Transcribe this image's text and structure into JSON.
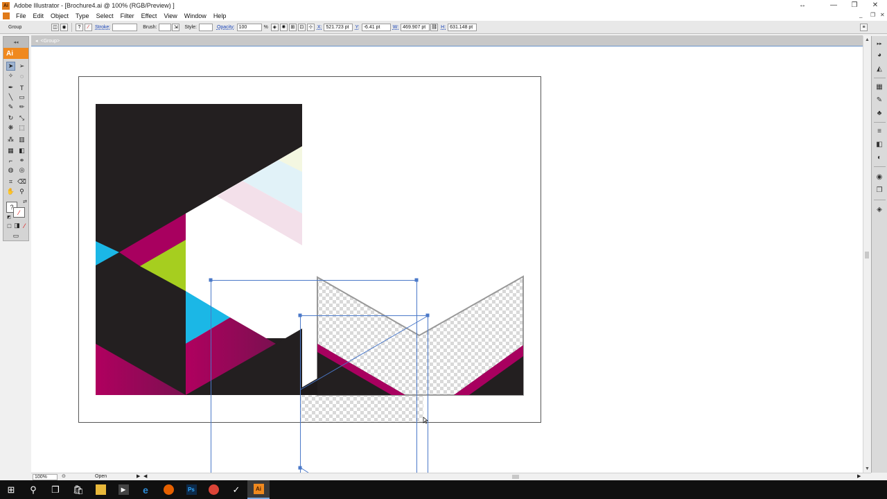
{
  "window": {
    "badge": "Ai",
    "title": "Adobe Illustrator - [Brochure4.ai @ 100% (RGB/Preview) ]"
  },
  "menu": [
    "File",
    "Edit",
    "Object",
    "Type",
    "Select",
    "Filter",
    "Effect",
    "View",
    "Window",
    "Help"
  ],
  "control_bar": {
    "selection_type": "Group",
    "stroke_label": "Stroke:",
    "brush_label": "Brush:",
    "style_label": "Style:",
    "opacity_label": "Opacity:",
    "opacity_value": "100",
    "opacity_unit": "%",
    "x_label": "X:",
    "x_value": "521.723 pt",
    "y_label": "Y:",
    "y_value": "-6.41 pt",
    "w_label": "W:",
    "w_value": "469.907 pt",
    "h_label": "H:",
    "h_value": "631.148 pt"
  },
  "document_tab": {
    "label": "<Group>"
  },
  "tools_panel": {
    "logo": "Ai"
  },
  "status_bar": {
    "zoom": "100%",
    "status": "Open"
  },
  "colors": {
    "dark": "#231f20",
    "magenta": "#a8005f",
    "cyan": "#1bb7e6",
    "lime": "#a6ce1f",
    "pale_yellow": "#f4f7e1",
    "pale_blue": "#e1f2f8",
    "pale_pink": "#f3e0ea",
    "selection": "#4a78c8",
    "ai_orange": "#f0891e"
  },
  "taskbar": {
    "items": [
      "windows-start",
      "search",
      "task-view",
      "store",
      "file-explorer",
      "edge",
      "firefox",
      "photoshop",
      "chrome",
      "pointer-app",
      "illustrator"
    ],
    "photoshop_label": "Ps",
    "illustrator_label": "Ai"
  }
}
